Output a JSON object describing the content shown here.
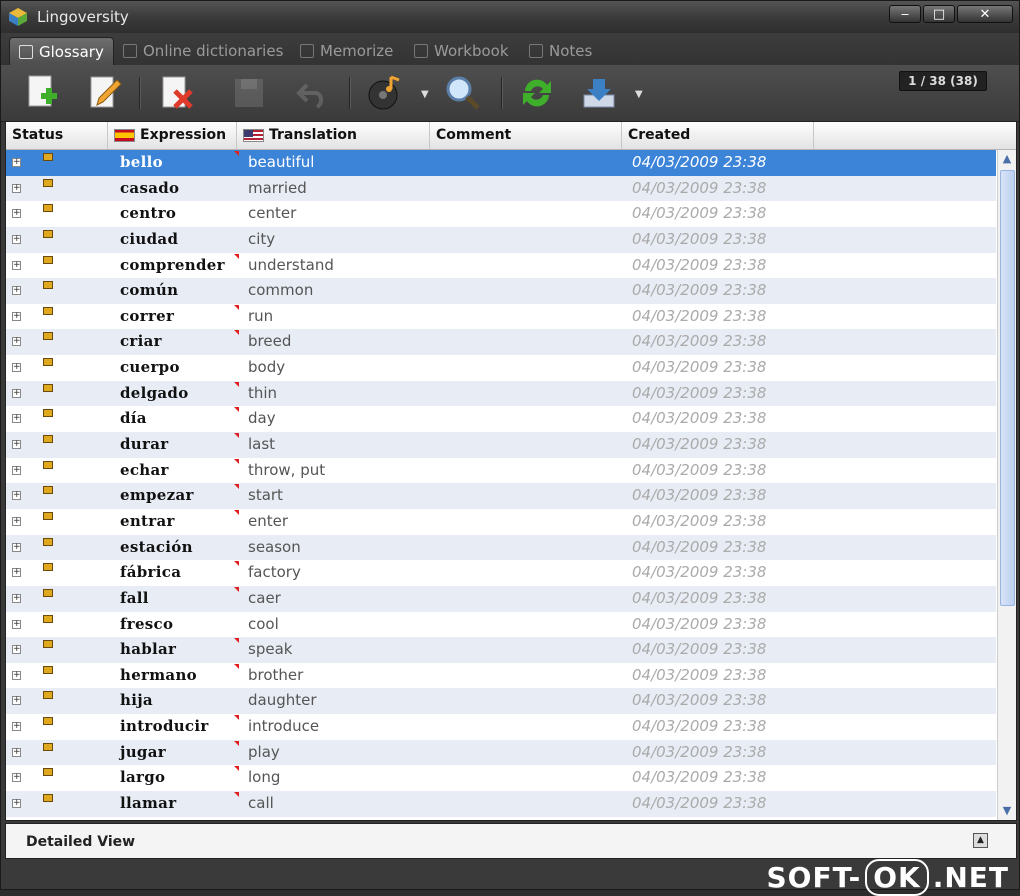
{
  "window": {
    "title": "Lingoversity"
  },
  "tabs": [
    {
      "label": "Glossary",
      "active": true
    },
    {
      "label": "Online dictionaries",
      "active": false
    },
    {
      "label": "Memorize",
      "active": false
    },
    {
      "label": "Workbook",
      "active": false
    },
    {
      "label": "Notes",
      "active": false
    }
  ],
  "toolbar": {
    "buttons": [
      "add-icon",
      "edit-icon",
      "delete-icon",
      "save-icon",
      "undo-icon",
      "audio-icon",
      "search-icon",
      "refresh-icon",
      "import-icon"
    ],
    "counter": "1 / 38 (38)"
  },
  "grid": {
    "columns": [
      "Status",
      "Expression",
      "Translation",
      "Comment",
      "Created"
    ],
    "rows": [
      {
        "expression": "bello",
        "translation": "beautiful",
        "created": "04/03/2009 23:38",
        "mark": true
      },
      {
        "expression": "casado",
        "translation": "married",
        "created": "04/03/2009 23:38",
        "mark": false
      },
      {
        "expression": "centro",
        "translation": "center",
        "created": "04/03/2009 23:38",
        "mark": false
      },
      {
        "expression": "ciudad",
        "translation": "city",
        "created": "04/03/2009 23:38",
        "mark": false
      },
      {
        "expression": "comprender",
        "translation": "understand",
        "created": "04/03/2009 23:38",
        "mark": true
      },
      {
        "expression": "común",
        "translation": "common",
        "created": "04/03/2009 23:38",
        "mark": false
      },
      {
        "expression": "correr",
        "translation": "run",
        "created": "04/03/2009 23:38",
        "mark": true
      },
      {
        "expression": "criar",
        "translation": "breed",
        "created": "04/03/2009 23:38",
        "mark": true
      },
      {
        "expression": "cuerpo",
        "translation": "body",
        "created": "04/03/2009 23:38",
        "mark": false
      },
      {
        "expression": "delgado",
        "translation": "thin",
        "created": "04/03/2009 23:38",
        "mark": true
      },
      {
        "expression": "día",
        "translation": "day",
        "created": "04/03/2009 23:38",
        "mark": true
      },
      {
        "expression": "durar",
        "translation": "last",
        "created": "04/03/2009 23:38",
        "mark": true
      },
      {
        "expression": "echar",
        "translation": "throw, put",
        "created": "04/03/2009 23:38",
        "mark": true
      },
      {
        "expression": "empezar",
        "translation": "start",
        "created": "04/03/2009 23:38",
        "mark": true
      },
      {
        "expression": "entrar",
        "translation": "enter",
        "created": "04/03/2009 23:38",
        "mark": true
      },
      {
        "expression": "estación",
        "translation": "season",
        "created": "04/03/2009 23:38",
        "mark": false
      },
      {
        "expression": "fábrica",
        "translation": "factory",
        "created": "04/03/2009 23:38",
        "mark": true
      },
      {
        "expression": "fall",
        "translation": "caer",
        "created": "04/03/2009 23:38",
        "mark": true
      },
      {
        "expression": "fresco",
        "translation": "cool",
        "created": "04/03/2009 23:38",
        "mark": false
      },
      {
        "expression": "hablar",
        "translation": "speak",
        "created": "04/03/2009 23:38",
        "mark": true
      },
      {
        "expression": "hermano",
        "translation": "brother",
        "created": "04/03/2009 23:38",
        "mark": true
      },
      {
        "expression": "hija",
        "translation": "daughter",
        "created": "04/03/2009 23:38",
        "mark": false
      },
      {
        "expression": "introducir",
        "translation": "introduce",
        "created": "04/03/2009 23:38",
        "mark": true
      },
      {
        "expression": "jugar",
        "translation": "play",
        "created": "04/03/2009 23:38",
        "mark": true
      },
      {
        "expression": "largo",
        "translation": "long",
        "created": "04/03/2009 23:38",
        "mark": true
      },
      {
        "expression": "llamar",
        "translation": "call",
        "created": "04/03/2009 23:38",
        "mark": true
      }
    ]
  },
  "detail": {
    "title": "Detailed View"
  },
  "watermark": {
    "left": "SOFT-",
    "box": "OK",
    "right": ".NET"
  },
  "colors": {
    "selection": "#3c84d8",
    "alt_row": "#e8edf5",
    "status_icon": "#e0a81c"
  }
}
